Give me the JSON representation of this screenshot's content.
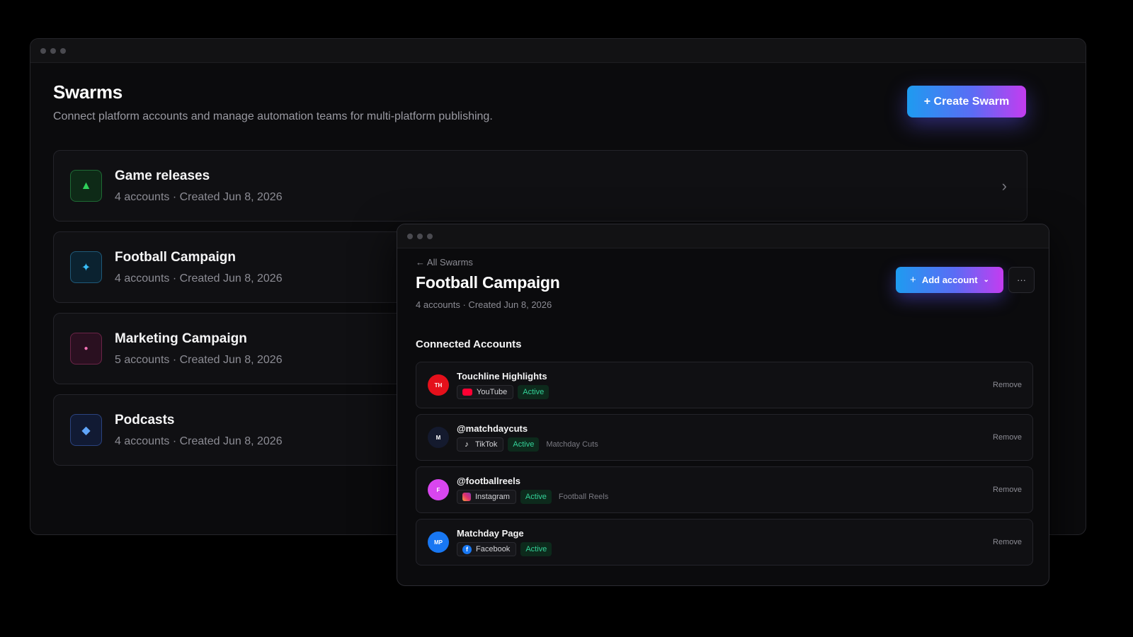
{
  "back_window": {
    "title": "Swarms",
    "subtitle": "Connect platform accounts and manage automation teams for multi-platform publishing.",
    "create_button": "+ Create Swarm",
    "swarms": [
      {
        "name": "Game releases",
        "meta": "4 accounts · Created Jun 8, 2026",
        "icon": "triangle-icon",
        "icon_glyph": "▲",
        "color": "#2fd05a"
      },
      {
        "name": "Football Campaign",
        "meta": "4 accounts · Created Jun 8, 2026",
        "icon": "sparkle-icon",
        "icon_glyph": "✦",
        "color": "#38bdf8"
      },
      {
        "name": "Marketing Campaign",
        "meta": "5 accounts · Created Jun 8, 2026",
        "icon": "dot-icon",
        "icon_glyph": "●",
        "color": "#f472b6"
      },
      {
        "name": "Podcasts",
        "meta": "4 accounts · Created Jun 8, 2026",
        "icon": "diamond-icon",
        "icon_glyph": "◆",
        "color": "#60a5fa"
      }
    ]
  },
  "front_window": {
    "back_link": "← All Swarms",
    "title": "Football Campaign",
    "meta": "4 accounts · Created Jun 8, 2026",
    "add_button": "Add account",
    "more_button": "···",
    "section_title": "Connected Accounts",
    "remove_label": "Remove",
    "accounts": [
      {
        "initials": "TH",
        "name": "Touchline Highlights",
        "platform": "YouTube",
        "platform_icon": "youtube-icon",
        "status": "Active",
        "extra": "",
        "avatar_color": "#e5101b"
      },
      {
        "initials": "M",
        "name": "@matchdaycuts",
        "platform": "TikTok",
        "platform_icon": "tiktok-icon",
        "status": "Active",
        "extra": "Matchday Cuts",
        "avatar_color": "#141a2e"
      },
      {
        "initials": "F",
        "name": "@footballreels",
        "platform": "Instagram",
        "platform_icon": "instagram-icon",
        "status": "Active",
        "extra": "Football Reels",
        "avatar_color": "#d946ef"
      },
      {
        "initials": "MP",
        "name": "Matchday Page",
        "platform": "Facebook",
        "platform_icon": "facebook-icon",
        "status": "Active",
        "extra": "",
        "avatar_color": "#1877f2"
      }
    ]
  }
}
